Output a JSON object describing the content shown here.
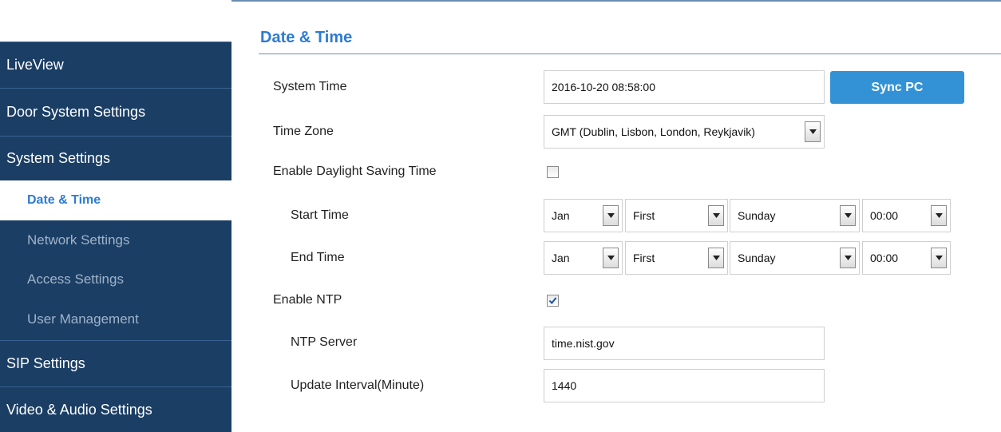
{
  "sidebar": {
    "items": [
      {
        "label": "LiveView"
      },
      {
        "label": "Door System Settings"
      },
      {
        "label": "System Settings"
      },
      {
        "label": "Date & Time"
      },
      {
        "label": "Network Settings"
      },
      {
        "label": "Access Settings"
      },
      {
        "label": "User Management"
      },
      {
        "label": "SIP Settings"
      },
      {
        "label": "Video & Audio Settings"
      }
    ]
  },
  "page": {
    "title": "Date & Time"
  },
  "form": {
    "system_time": {
      "label": "System Time",
      "value": "2016-10-20 08:58:00"
    },
    "sync_button": "Sync PC",
    "time_zone": {
      "label": "Time Zone",
      "value": "GMT (Dublin, Lisbon, London, Reykjavik)"
    },
    "dst": {
      "label": "Enable Daylight Saving Time",
      "checked": false
    },
    "start_time": {
      "label": "Start Time",
      "month": "Jan",
      "week": "First",
      "day": "Sunday",
      "time": "00:00"
    },
    "end_time": {
      "label": "End Time",
      "month": "Jan",
      "week": "First",
      "day": "Sunday",
      "time": "00:00"
    },
    "ntp": {
      "label": "Enable NTP",
      "checked": true
    },
    "ntp_server": {
      "label": "NTP Server",
      "value": "time.nist.gov"
    },
    "update_interval": {
      "label": "Update Interval(Minute)",
      "value": "1440"
    }
  },
  "colors": {
    "sidebar_bg": "#1b3e65",
    "accent": "#2d7bd2",
    "button": "#3392d6"
  },
  "icons": {
    "dropdown": "chevron-down-icon",
    "check": "check-icon"
  }
}
